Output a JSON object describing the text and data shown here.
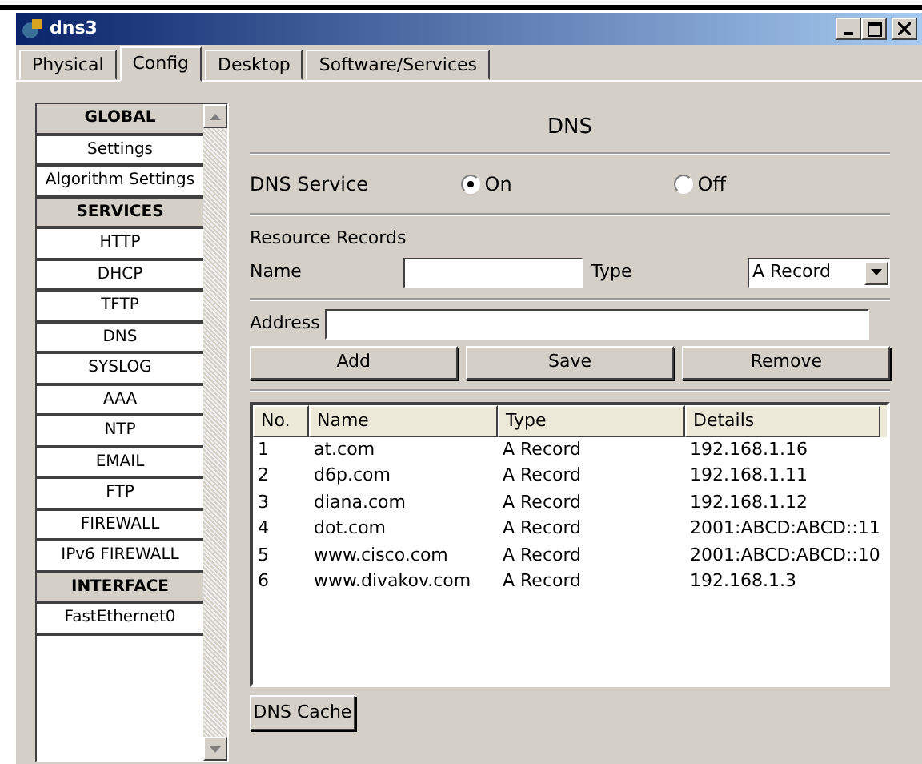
{
  "window": {
    "title": "dns3"
  },
  "tabs": [
    {
      "label": "Physical",
      "selected": false
    },
    {
      "label": "Config",
      "selected": true
    },
    {
      "label": "Desktop",
      "selected": false
    },
    {
      "label": "Software/Services",
      "selected": false
    }
  ],
  "sidebar": {
    "items": [
      {
        "kind": "header",
        "label": "GLOBAL"
      },
      {
        "kind": "item",
        "label": "Settings"
      },
      {
        "kind": "item",
        "label": "Algorithm Settings"
      },
      {
        "kind": "header",
        "label": "SERVICES"
      },
      {
        "kind": "item",
        "label": "HTTP"
      },
      {
        "kind": "item",
        "label": "DHCP"
      },
      {
        "kind": "item",
        "label": "TFTP"
      },
      {
        "kind": "item",
        "label": "DNS"
      },
      {
        "kind": "item",
        "label": "SYSLOG"
      },
      {
        "kind": "item",
        "label": "AAA"
      },
      {
        "kind": "item",
        "label": "NTP"
      },
      {
        "kind": "item",
        "label": "EMAIL"
      },
      {
        "kind": "item",
        "label": "FTP"
      },
      {
        "kind": "item",
        "label": "FIREWALL"
      },
      {
        "kind": "item",
        "label": "IPv6 FIREWALL"
      },
      {
        "kind": "header",
        "label": "INTERFACE"
      },
      {
        "kind": "item",
        "label": "FastEthernet0"
      }
    ]
  },
  "panel": {
    "title": "DNS",
    "service_label": "DNS Service",
    "service_options": [
      {
        "label": "On",
        "selected": true
      },
      {
        "label": "Off",
        "selected": false
      }
    ],
    "section_label": "Resource Records",
    "name_label": "Name",
    "type_label": "Type",
    "type_value": "A Record",
    "address_label": "Address",
    "buttons": [
      "Add",
      "Save",
      "Remove"
    ],
    "table": {
      "columns": [
        "No.",
        "Name",
        "Type",
        "Details"
      ],
      "rows": [
        [
          "1",
          "at.com",
          "A Record",
          "192.168.1.16"
        ],
        [
          "2",
          "d6p.com",
          "A Record",
          "192.168.1.11"
        ],
        [
          "3",
          "diana.com",
          "A Record",
          "192.168.1.12"
        ],
        [
          "4",
          "dot.com",
          "A Record",
          "2001:ABCD:ABCD::11"
        ],
        [
          "5",
          "www.cisco.com",
          "A Record",
          "2001:ABCD:ABCD::10"
        ],
        [
          "6",
          "www.divakov.com",
          "A Record",
          "192.168.1.3"
        ]
      ]
    },
    "cache_button": "DNS Cache"
  }
}
